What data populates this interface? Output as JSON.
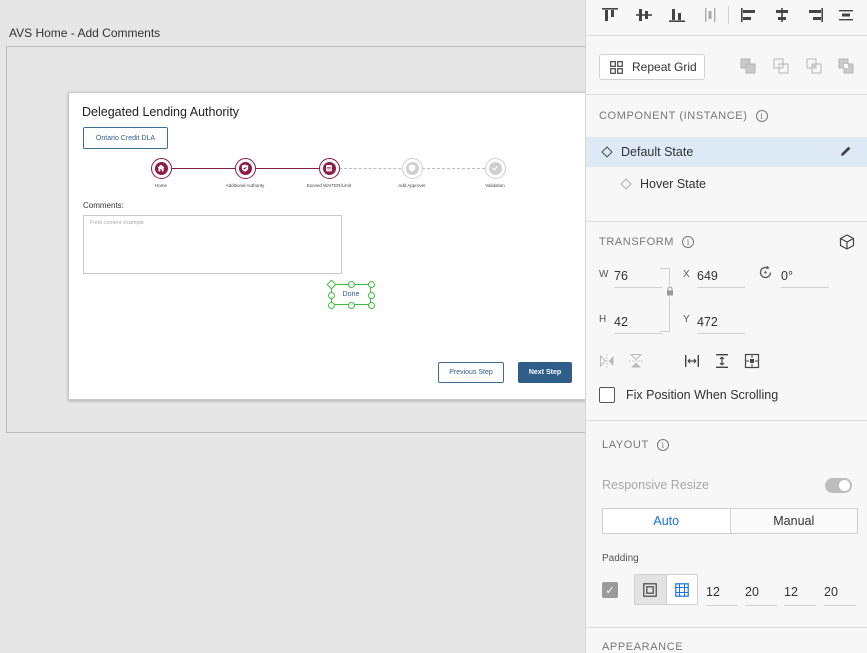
{
  "canvas": {
    "artboard_title": "AVS Home - Add Comments",
    "card": {
      "title": "Delegated Lending Authority",
      "dla_button": "Ontario Credit DLA",
      "steps": [
        {
          "label": "Home",
          "status": "completed",
          "icon": "home-icon"
        },
        {
          "label": "Additional Authority",
          "status": "completed",
          "icon": "shield-check-icon"
        },
        {
          "label": "Exceed WAITER/Limit",
          "status": "completed",
          "icon": "document-icon"
        },
        {
          "label": "Add Approver",
          "status": "pending",
          "icon": "shield-icon"
        },
        {
          "label": "Validation",
          "status": "pending",
          "icon": "check-icon"
        }
      ],
      "comments_label": "Comments:",
      "comments_placeholder": "Field content example",
      "done_button": "Done",
      "previous_button": "Previous Step",
      "next_button": "Next Step"
    }
  },
  "panel": {
    "repeat_grid": "Repeat Grid",
    "component_title": "COMPONENT (INSTANCE)",
    "states": [
      {
        "label": "Default State",
        "selected": true
      },
      {
        "label": "Hover State",
        "selected": false
      }
    ],
    "transform": {
      "title": "TRANSFORM",
      "w_label": "W",
      "w_value": "76",
      "x_label": "X",
      "x_value": "649",
      "rotation_value": "0°",
      "h_label": "H",
      "h_value": "42",
      "y_label": "Y",
      "y_value": "472"
    },
    "fix_position_label": "Fix Position When Scrolling",
    "layout": {
      "title": "LAYOUT",
      "responsive_resize_label": "Responsive Resize",
      "segments": [
        "Auto",
        "Manual"
      ],
      "padding_label": "Padding",
      "padding_values": [
        "12",
        "20",
        "12",
        "20"
      ]
    },
    "appearance_title": "APPEARANCE"
  },
  "colors": {
    "accent_maroon": "#8a1c45",
    "primary_blue": "#2f5f88",
    "selection_green": "#3fbf3f",
    "selected_row": "#dde9f5",
    "auto_blue": "#1473e6"
  }
}
